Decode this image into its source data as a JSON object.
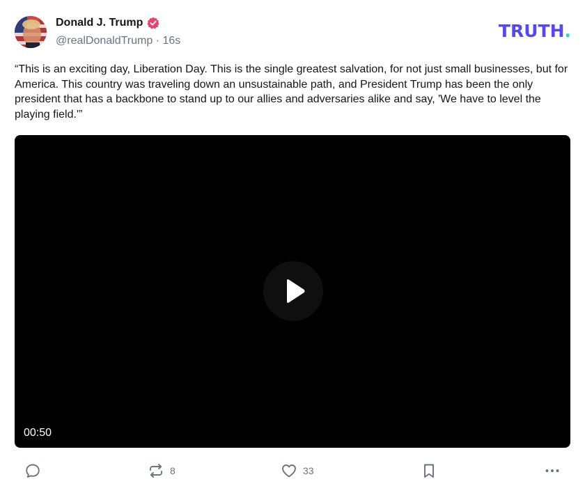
{
  "post": {
    "author": {
      "display_name": "Donald J. Trump",
      "handle": "@realDonaldTrump",
      "separator": "·",
      "time_ago": "16s",
      "verified_color": "#e2456f"
    },
    "text": "“This is an exciting day, Liberation Day. This is the single greatest salvation, for not just small businesses, but for America. This country was traveling down an unsustainable path, and President Trump has been the only president that has a backbone to stand up to our allies and adversaries alike and say, 'We have to level the playing field.'”",
    "video": {
      "duration": "00:50"
    },
    "actions": {
      "reply_count": "",
      "retruth_count": "8",
      "like_count": "33"
    }
  },
  "brand": {
    "logo_text": "TRUTH",
    "logo_dot": ".",
    "primary_color": "#5448ee",
    "accent_color": "#2fd3c6"
  },
  "icons": [
    "verified-badge-icon",
    "play-icon",
    "reply-icon",
    "retruth-icon",
    "like-icon",
    "bookmark-icon",
    "more-icon"
  ]
}
